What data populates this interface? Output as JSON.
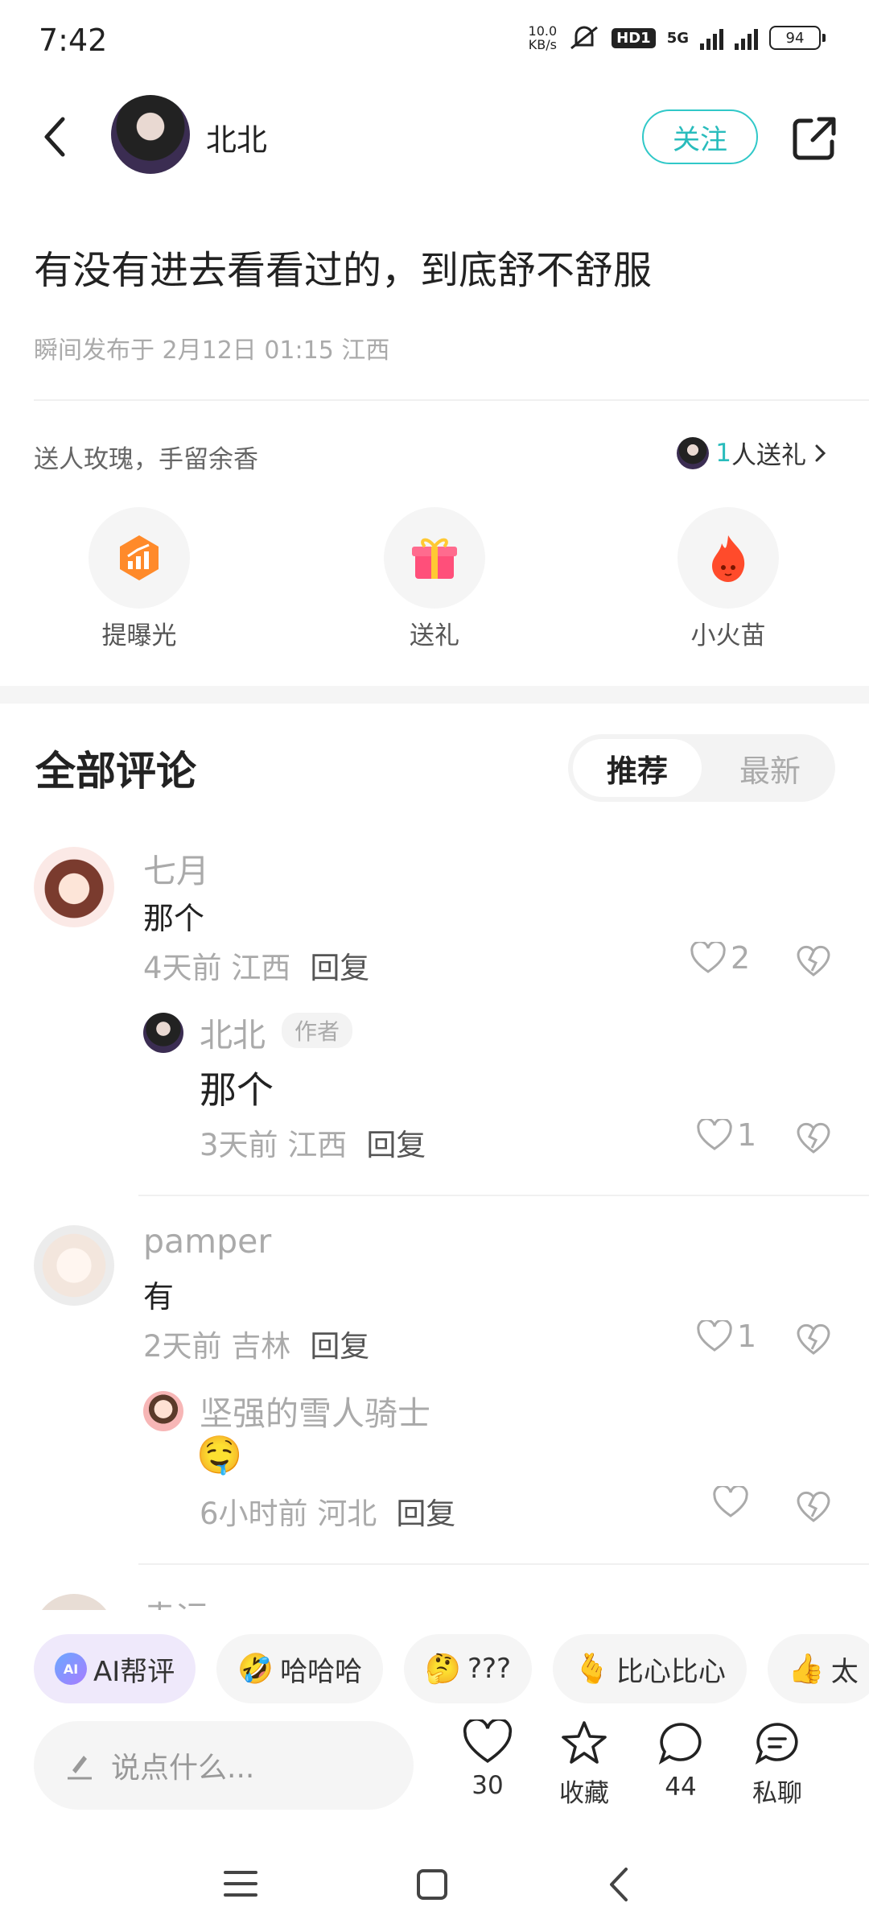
{
  "status": {
    "time": "7:42",
    "net_speed_top": "10.0",
    "net_speed_unit": "KB/s",
    "hd": "HD1",
    "net_type": "5G",
    "battery": "94"
  },
  "header": {
    "author": "北北",
    "follow_label": "关注"
  },
  "post": {
    "title": "有没有进去看看过的，到底舒不舒服",
    "meta": "瞬间发布于 2月12日 01:15 江西"
  },
  "gift": {
    "hint": "送人玫瑰，手留余香",
    "count": "1",
    "count_suffix": "人送礼"
  },
  "actions": [
    {
      "label": "提曝光",
      "icon": "exposure-icon"
    },
    {
      "label": "送礼",
      "icon": "gift-icon"
    },
    {
      "label": "小火苗",
      "icon": "flame-icon"
    }
  ],
  "comments_section": {
    "title": "全部评论",
    "tab_recommend": "推荐",
    "tab_latest": "最新"
  },
  "comments": [
    {
      "name": "七月",
      "text": "那个",
      "time": "4天前",
      "region": "江西",
      "reply": "回复",
      "likes": "2",
      "sub": {
        "name": "北北",
        "tag": "作者",
        "text": "那个",
        "time": "3天前",
        "region": "江西",
        "reply": "回复",
        "likes": "1"
      }
    },
    {
      "name": "pamper",
      "text": "有",
      "time": "2天前",
      "region": "吉林",
      "reply": "回复",
      "likes": "1",
      "sub": {
        "name": "坚强的雪人骑士",
        "text": "🤤",
        "time": "6小时前",
        "region": "河北",
        "reply": "回复",
        "likes": ""
      }
    },
    {
      "name": "幸运"
    }
  ],
  "quick_replies": [
    {
      "label": "AI帮评",
      "emoji": ""
    },
    {
      "label": "哈哈哈",
      "emoji": "🤣"
    },
    {
      "label": "???",
      "emoji": "🤔"
    },
    {
      "label": "比心比心",
      "emoji": "🫰"
    },
    {
      "label": "太",
      "emoji": "👍"
    }
  ],
  "bottom": {
    "input_placeholder": "说点什么...",
    "likes": "30",
    "favorite_label": "收藏",
    "comments": "44",
    "chat_label": "私聊"
  }
}
